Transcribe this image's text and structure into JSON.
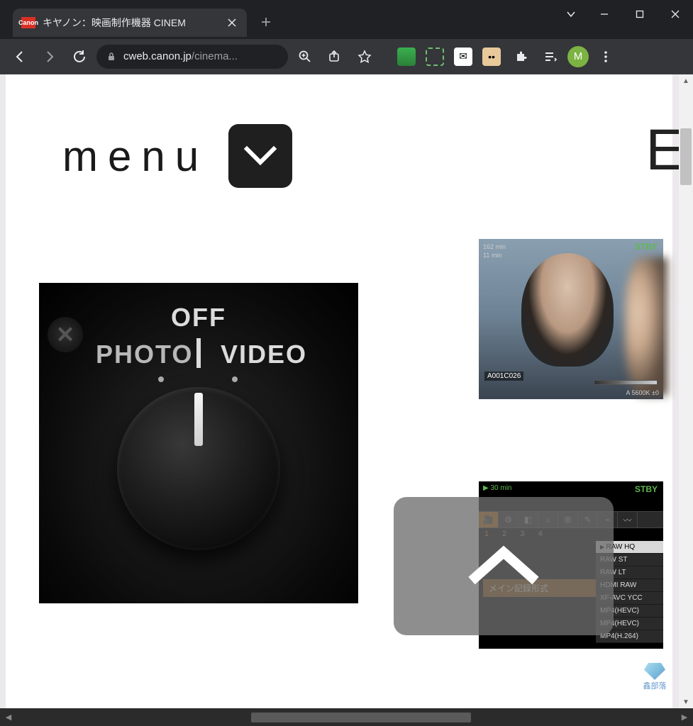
{
  "window": {
    "tab_title": "キヤノン：映画制作機器 CINEM",
    "favicon_text": "Canon"
  },
  "toolbar": {
    "url_host": "cweb.canon.jp",
    "url_path": "/cinema...",
    "avatar_letter": "M"
  },
  "page": {
    "menu_label": "menu",
    "big_letter": "E",
    "dial": {
      "off": "OFF",
      "photo": "PHOTO",
      "video": "VIDEO"
    },
    "preview1": {
      "stby": "STBY",
      "clip": "A001C026",
      "wb": "A 5600K ±0",
      "top_left_1": "162 min",
      "top_left_2": "11 min"
    },
    "preview2": {
      "stby": "STBY",
      "top_left": "▶ 30 min",
      "nums": [
        "1",
        "2",
        "3",
        "4"
      ],
      "main_label": "メイン記録形式",
      "menu_items": [
        "RAW HQ",
        "RAW ST",
        "RAW LT",
        "HDMI RAW",
        "XF-AVC YCC",
        "MP4(HEVC)",
        "MP4(HEVC)",
        "MP4(H.264)"
      ],
      "selected_index": 0
    },
    "watermark_text": "鑫部落"
  }
}
